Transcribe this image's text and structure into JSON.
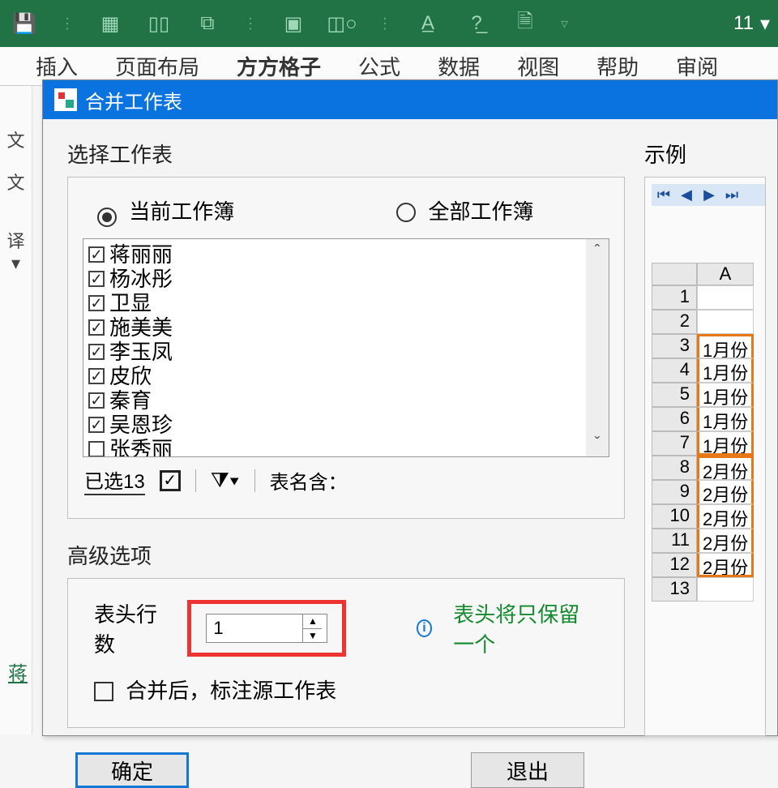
{
  "ribbon": {
    "font_size": "11"
  },
  "menu": {
    "items": [
      "插入",
      "页面布局",
      "方方格子",
      "公式",
      "数据",
      "视图",
      "帮助",
      "审阅"
    ],
    "active_index": 2
  },
  "left_strip": {
    "char1": "文",
    "char2": "文",
    "char3": "译 ▾",
    "tab": "蒋"
  },
  "dialog": {
    "title": "合并工作表",
    "select_label": "选择工作表",
    "radio_current": "当前工作簿",
    "radio_all": "全部工作簿",
    "items": [
      {
        "name": "蒋丽丽",
        "checked": true
      },
      {
        "name": "杨冰彤",
        "checked": true
      },
      {
        "name": "卫显",
        "checked": true
      },
      {
        "name": "施美美",
        "checked": true
      },
      {
        "name": "李玉凤",
        "checked": true
      },
      {
        "name": "皮欣",
        "checked": true
      },
      {
        "name": "秦育",
        "checked": true
      },
      {
        "name": "吴恩珍",
        "checked": true
      },
      {
        "name": "张秀丽",
        "checked": false
      }
    ],
    "selected_count": "已选13",
    "tabname_label": "表名含：",
    "advanced_label": "高级选项",
    "header_rows_label": "表头行数",
    "header_rows_value": "1",
    "info_text": "表头将只保留一个",
    "mark_source": "合并后，标注源工作表",
    "ok": "确定",
    "cancel": "退出"
  },
  "example": {
    "label": "示例",
    "col": "A",
    "rows": [
      {
        "n": "1",
        "v": ""
      },
      {
        "n": "2",
        "v": ""
      },
      {
        "n": "3",
        "v": "1月份"
      },
      {
        "n": "4",
        "v": "1月份"
      },
      {
        "n": "5",
        "v": "1月份"
      },
      {
        "n": "6",
        "v": "1月份"
      },
      {
        "n": "7",
        "v": "1月份"
      },
      {
        "n": "8",
        "v": "2月份"
      },
      {
        "n": "9",
        "v": "2月份"
      },
      {
        "n": "10",
        "v": "2月份"
      },
      {
        "n": "11",
        "v": "2月份"
      },
      {
        "n": "12",
        "v": "2月份"
      },
      {
        "n": "13",
        "v": ""
      }
    ]
  }
}
